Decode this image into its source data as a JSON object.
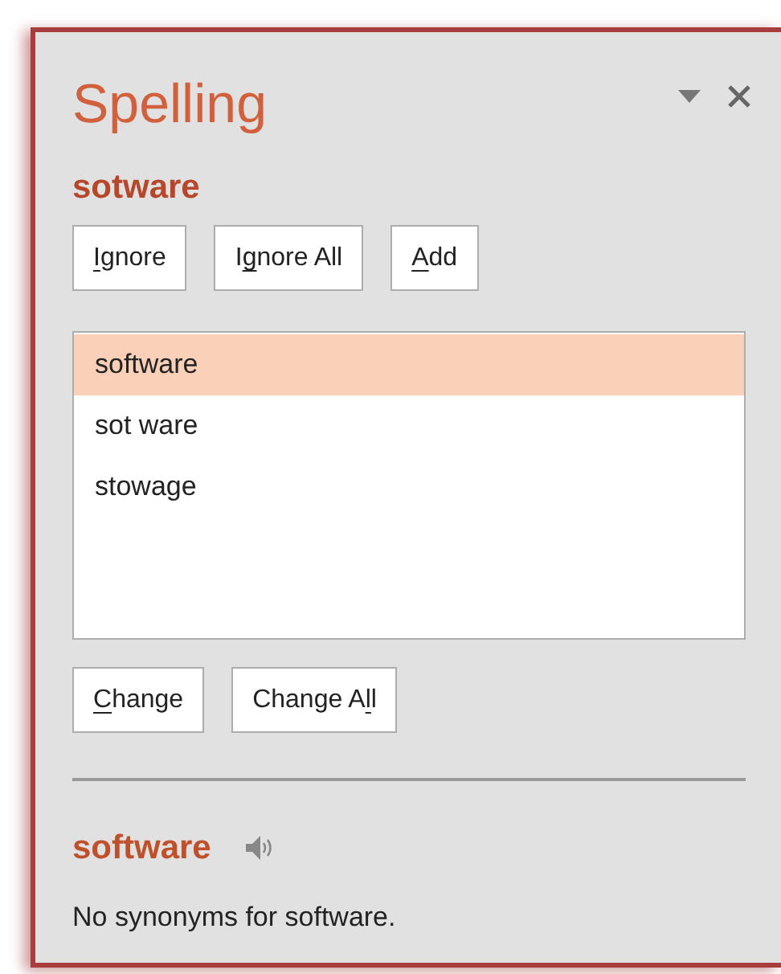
{
  "pane": {
    "title": "Spelling",
    "misspelled_word": "sotware",
    "top_buttons": [
      {
        "parts": [
          {
            "text": "I",
            "access_key": true
          },
          {
            "text": "gnore",
            "access_key": false
          }
        ]
      },
      {
        "parts": [
          {
            "text": "I",
            "access_key": false
          },
          {
            "text": "g",
            "access_key": true
          },
          {
            "text": "nore All",
            "access_key": false
          }
        ]
      },
      {
        "parts": [
          {
            "text": "A",
            "access_key": true
          },
          {
            "text": "dd",
            "access_key": false
          }
        ]
      }
    ],
    "suggestions": [
      {
        "text": "software",
        "selected": true
      },
      {
        "text": "sot ware",
        "selected": false
      },
      {
        "text": "stowage",
        "selected": false
      }
    ],
    "change_buttons": [
      {
        "parts": [
          {
            "text": "C",
            "access_key": true
          },
          {
            "text": "hange",
            "access_key": false
          }
        ]
      },
      {
        "parts": [
          {
            "text": "Change A",
            "access_key": false
          },
          {
            "text": "l",
            "access_key": true
          },
          {
            "text": "l",
            "access_key": false
          }
        ]
      }
    ],
    "synonyms": {
      "word": "software",
      "message": "No synonyms for software."
    }
  }
}
